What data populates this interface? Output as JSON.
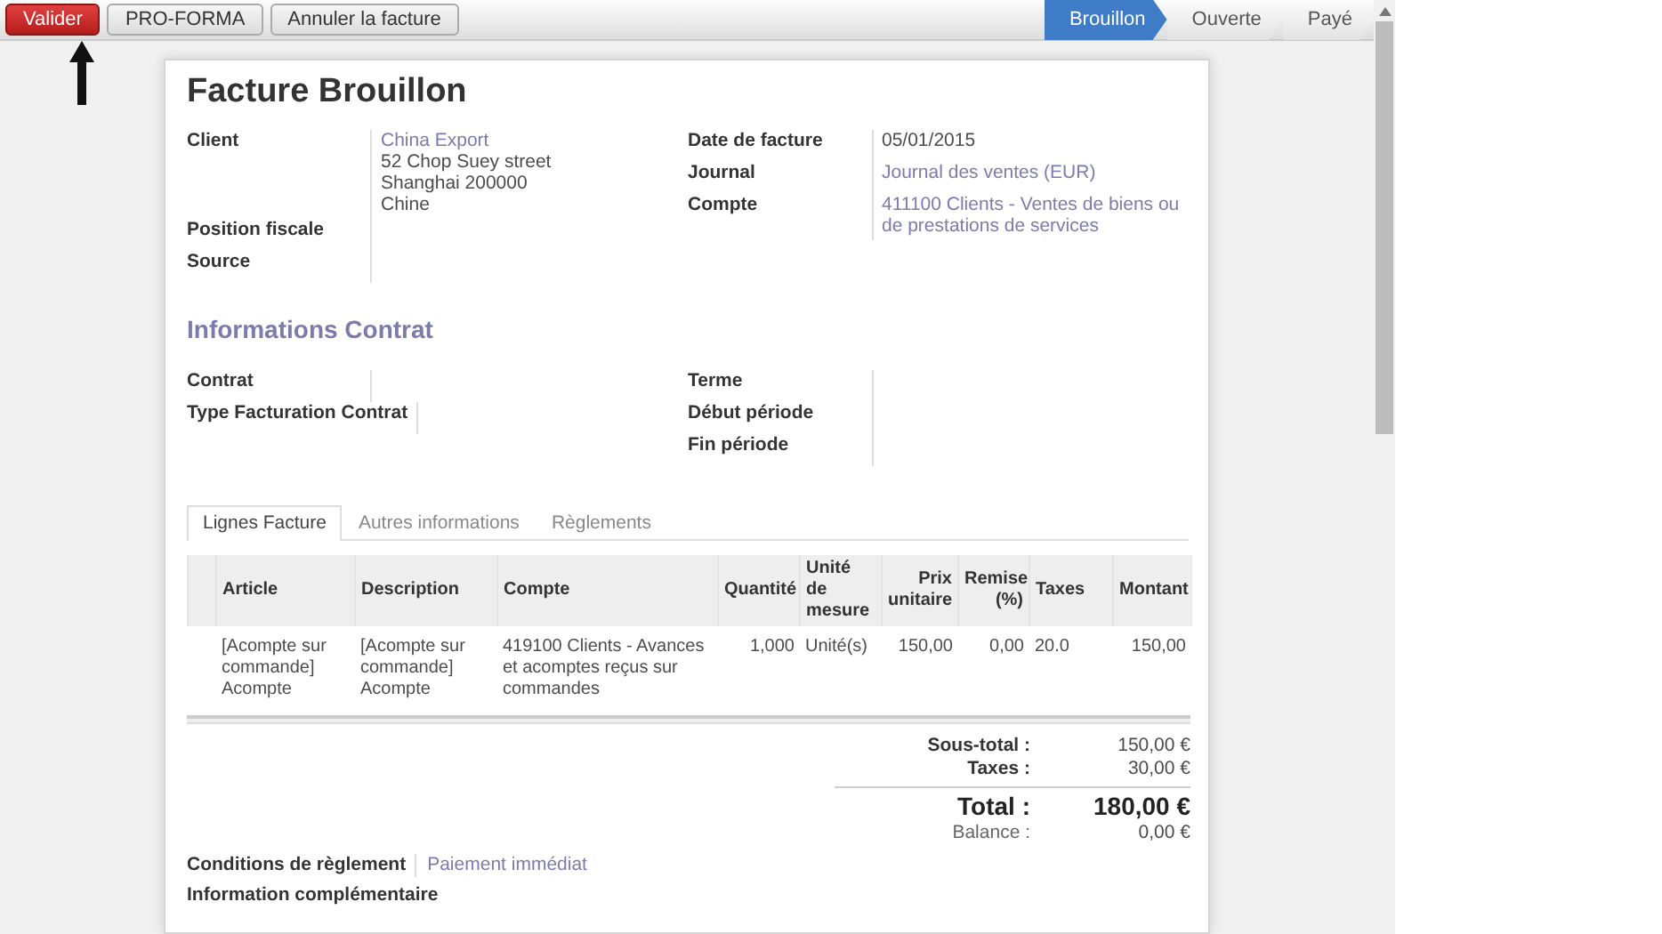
{
  "toolbar": {
    "buttons": [
      {
        "label": "Valider",
        "kind": "primary"
      },
      {
        "label": "PRO-FORMA",
        "kind": "default"
      },
      {
        "label": "Annuler la facture",
        "kind": "default"
      }
    ]
  },
  "status_steps": [
    {
      "label": "Brouillon",
      "selected": true
    },
    {
      "label": "Ouverte",
      "selected": false
    },
    {
      "label": "Payé",
      "selected": false
    }
  ],
  "sheet": {
    "title": "Facture Brouillon",
    "left_fields": [
      {
        "label": "Client",
        "values": [
          {
            "text": "China Export",
            "kind": "link"
          },
          {
            "text": "52 Chop Suey street",
            "kind": "text"
          },
          {
            "text": "Shanghai 200000",
            "kind": "text"
          },
          {
            "text": "Chine",
            "kind": "text"
          }
        ]
      },
      {
        "label": "Position fiscale"
      },
      {
        "label": "Source"
      }
    ],
    "right_fields": [
      {
        "label": "Date de facture",
        "values": [
          {
            "text": "05/01/2015",
            "kind": "text"
          }
        ]
      },
      {
        "label": "Journal",
        "values": [
          {
            "text": "Journal des ventes (EUR)",
            "kind": "link"
          }
        ]
      },
      {
        "label": "Compte",
        "values": [
          {
            "text": "411100 Clients - Ventes de biens ou de prestations de services",
            "kind": "link"
          }
        ]
      }
    ],
    "section_title": "Informations Contrat",
    "contract_left": [
      {
        "label": "Contrat"
      },
      {
        "label": "Type Facturation Contrat"
      }
    ],
    "contract_right": [
      {
        "label": "Terme"
      },
      {
        "label": "Début période"
      },
      {
        "label": "Fin période"
      }
    ],
    "tabs": [
      {
        "label": "Lignes Facture",
        "selected": true
      },
      {
        "label": "Autres informations",
        "selected": false
      },
      {
        "label": "Règlements",
        "selected": false
      }
    ],
    "table": {
      "columns": [
        {
          "label": "Article",
          "kind": "text"
        },
        {
          "label": "Description",
          "kind": "text"
        },
        {
          "label": "Compte",
          "kind": "text"
        },
        {
          "label": "Quantité",
          "kind": "number"
        },
        {
          "label": "Unité de mesure",
          "kind": "text"
        },
        {
          "label": "Prix unitaire",
          "kind": "number"
        },
        {
          "label": "Remise (%)",
          "kind": "number"
        },
        {
          "label": "Taxes",
          "kind": "text"
        },
        {
          "label": "Montant",
          "kind": "number"
        }
      ],
      "rows": [
        {
          "cells": [
            "[Acompte sur commande] Acompte",
            "[Acompte sur commande] Acompte",
            "419100 Clients - Avances et acomptes reçus sur commandes",
            "1,000",
            "Unité(s)",
            "150,00",
            "0,00",
            "20.0",
            "150,00"
          ]
        }
      ]
    },
    "totals": [
      {
        "label": "Sous-total :",
        "value": "150,00 €",
        "kind": "normal"
      },
      {
        "label": "Taxes :",
        "value": "30,00 €",
        "kind": "normal"
      },
      {
        "label": "Total :",
        "value": "180,00 €",
        "kind": "grand"
      },
      {
        "label": "Balance :",
        "value": "0,00 €",
        "kind": "muted"
      }
    ],
    "payment_terms": {
      "label": "Conditions de règlement",
      "value": "Paiement immédiat"
    },
    "extra_info_label": "Information complémentaire"
  }
}
